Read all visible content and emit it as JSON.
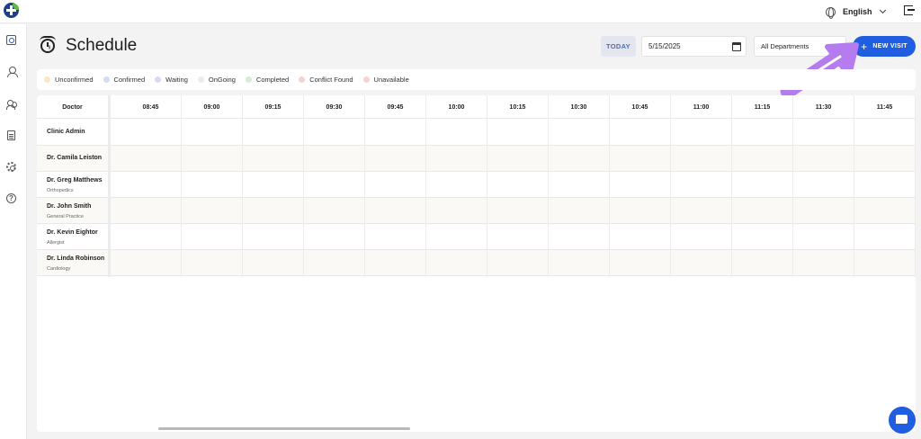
{
  "header": {
    "language": "English"
  },
  "page": {
    "title": "Schedule"
  },
  "toolbar": {
    "today_label": "TODAY",
    "date_value": "5/15/2025",
    "department_value": "All Departments",
    "new_visit_label": "NEW VISIT"
  },
  "legend": [
    {
      "label": "Unconfirmed",
      "color": "#fbe7c4"
    },
    {
      "label": "Confirmed",
      "color": "#d2dcf6"
    },
    {
      "label": "Waiting",
      "color": "#e2d4f6"
    },
    {
      "label": "OnGoing",
      "color": "#ececec"
    },
    {
      "label": "Completed",
      "color": "#d3efd3"
    },
    {
      "label": "Conflict Found",
      "color": "#f8d2d2"
    },
    {
      "label": "Unavailable",
      "color": "#f7d4d4"
    }
  ],
  "grid": {
    "doctor_header": "Doctor",
    "times": [
      "08:45",
      "09:00",
      "09:15",
      "09:30",
      "09:45",
      "10:00",
      "10:15",
      "10:30",
      "10:45",
      "11:00",
      "11:15",
      "11:30",
      "11:45"
    ],
    "doctors": [
      {
        "name": "Clinic Admin",
        "specialty": ""
      },
      {
        "name": "Dr. Camila Leiston",
        "specialty": ""
      },
      {
        "name": "Dr. Greg Matthews",
        "specialty": "Orthopedics"
      },
      {
        "name": "Dr. John Smith",
        "specialty": "General Practice"
      },
      {
        "name": "Dr. Kevin Eightor",
        "specialty": "Allergist"
      },
      {
        "name": "Dr. Linda Robinson",
        "specialty": "Cardiology"
      }
    ]
  },
  "colors": {
    "accent": "#1f5ee0",
    "annotation_arrow": "#b57cf0"
  }
}
